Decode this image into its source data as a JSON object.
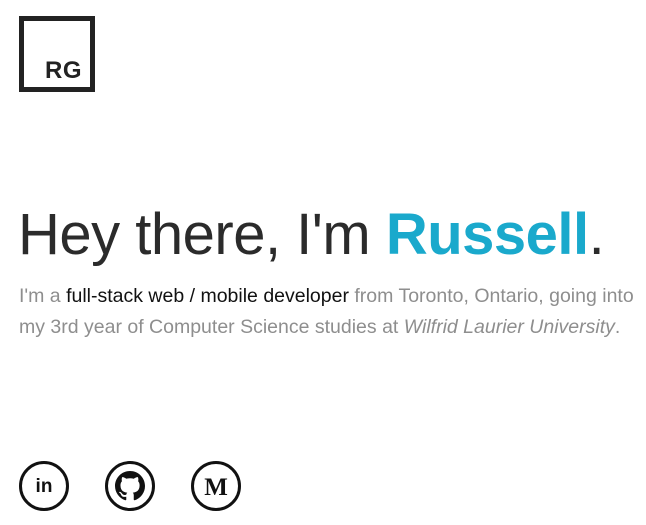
{
  "logo": {
    "text": "RG"
  },
  "hero": {
    "greeting": "Hey there, I'm ",
    "name": "Russell",
    "period": "."
  },
  "bio": {
    "part1": "I'm a ",
    "highlight": "full-stack web / mobile developer",
    "part2": " from Toronto, Ontario, going into my 3rd year of Computer Science studies at ",
    "university": "Wilfrid Laurier University",
    "part3": "."
  },
  "social": [
    {
      "icon": "linkedin-icon",
      "glyph": "in"
    },
    {
      "icon": "github-icon",
      "glyph": ""
    },
    {
      "icon": "medium-icon",
      "glyph": "M"
    }
  ],
  "colors": {
    "accent": "#1aa9cc",
    "heading": "#2b2b2b",
    "body_muted": "#8e8e8e",
    "highlight": "#111111"
  }
}
